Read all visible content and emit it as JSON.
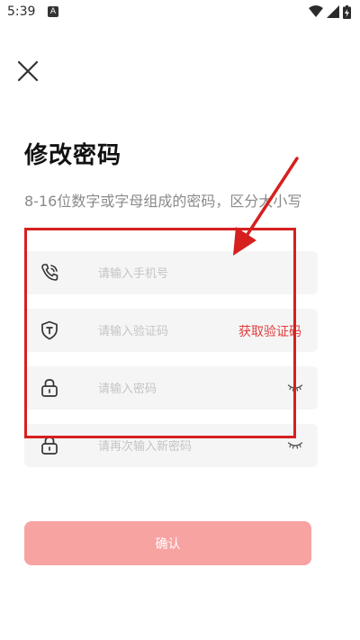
{
  "status_bar": {
    "time": "5:39",
    "notification_badge": "A",
    "icons": [
      "wifi-icon",
      "signal-icon",
      "battery-charging-icon"
    ]
  },
  "header": {
    "close_icon": "close-icon"
  },
  "page": {
    "title": "修改密码",
    "subtitle": "8-16位数字或字母组成的密码，区分大小写"
  },
  "form": {
    "phone": {
      "placeholder": "请输入手机号",
      "value": "",
      "icon": "phone-icon"
    },
    "code": {
      "placeholder": "请输入验证码",
      "value": "",
      "icon": "shield-icon",
      "get_code_label": "获取验证码"
    },
    "password": {
      "placeholder": "请输入密码",
      "value": "",
      "icon": "lock-icon",
      "toggle_icon": "eye-closed-icon"
    },
    "confirm_password": {
      "placeholder": "请再次输入新密码",
      "value": "",
      "icon": "lock-icon",
      "toggle_icon": "eye-closed-icon"
    },
    "submit_label": "确认"
  },
  "colors": {
    "accent": "#e23c3c",
    "button_bg": "#f7a3a2",
    "field_bg": "#f5f5f5",
    "annotation": "#d62020"
  }
}
